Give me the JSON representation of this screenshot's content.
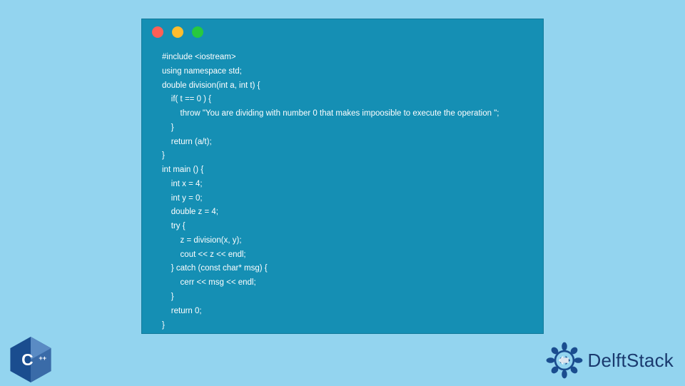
{
  "code": {
    "lines": [
      "#include <iostream>",
      "using namespace std;",
      "double division(int a, int t) {",
      "    if( t == 0 ) {",
      "        throw \"You are dividing with number 0 that makes impoosible to execute the operation \";",
      "    }",
      "    return (a/t);",
      "}",
      "int main () {",
      "    int x = 4;",
      "    int y = 0;",
      "    double z = 4;",
      "    try {",
      "        z = division(x, y);",
      "        cout << z << endl;",
      "    } catch (const char* msg) {",
      "        cerr << msg << endl;",
      "    }",
      "    return 0;",
      "}"
    ]
  },
  "branding": {
    "cpp_label": "C++",
    "site_name": "DelftStack"
  },
  "colors": {
    "background": "#93d4ef",
    "code_bg": "#158fb4",
    "code_text": "#ffffff",
    "brand_blue": "#1a3a6e"
  }
}
